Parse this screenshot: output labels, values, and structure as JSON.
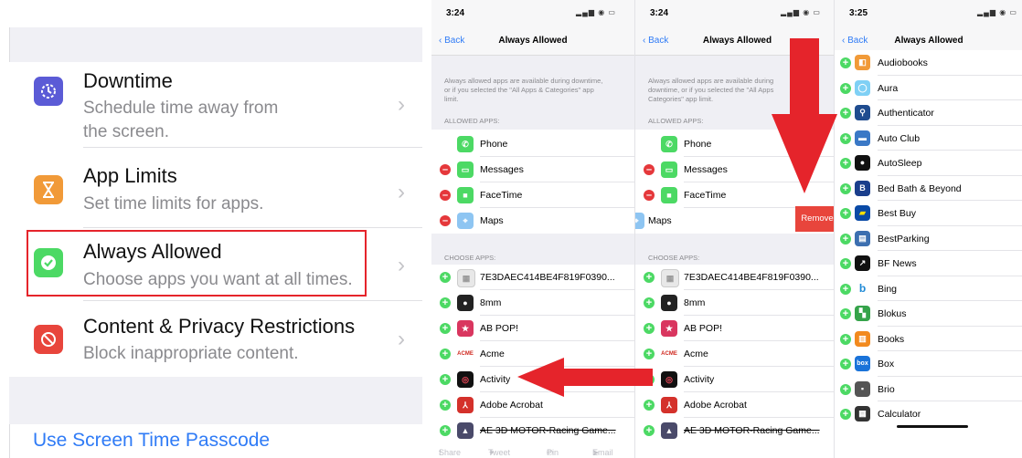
{
  "settings": {
    "rows": [
      {
        "title": "Downtime",
        "subtitle1": "Schedule time away from",
        "subtitle2": "the screen.",
        "icon": "downtime-icon",
        "color": "#5b5bd6"
      },
      {
        "title": "App Limits",
        "subtitle1": "Set time limits for apps.",
        "icon": "hourglass-icon",
        "color": "#f19a38"
      },
      {
        "title": "Always Allowed",
        "subtitle1": "Choose apps you want at all times.",
        "icon": "checkmark-badge-icon",
        "color": "#4cd964"
      },
      {
        "title": "Content & Privacy Restrictions",
        "subtitle1": "Block inappropriate content.",
        "icon": "no-entry-icon",
        "color": "#e8453c"
      }
    ],
    "passcode_link": "Use Screen Time Passcode",
    "chevron": "›"
  },
  "panels": [
    {
      "time": "3:24",
      "back": "Back",
      "title": "Always Allowed"
    },
    {
      "time": "3:24",
      "back": "Back",
      "title": "Always Allowed"
    },
    {
      "time": "3:25",
      "back": "Back",
      "title": "Always Allowed"
    }
  ],
  "always_allowed": {
    "description": "Always allowed apps are available during downtime, or if you selected the \"All Apps & Categories\" app limit.",
    "description_clipped": "Always allowed apps are available during downtime, or if you selected the \"All Apps Categories\" app limit.",
    "allowed_header": "ALLOWED APPS:",
    "choose_header": "CHOOSE APPS:",
    "allowed_apps": [
      "Phone",
      "Messages",
      "FaceTime",
      "Maps"
    ],
    "choose_apps": [
      "7E3DAEC414BE4F819F0390...",
      "8mm",
      "AB POP!",
      "Acme",
      "Activity",
      "Adobe Acrobat",
      "AE 3D MOTOR-Racing Game..."
    ],
    "remove_label": "Remove"
  },
  "az_list": [
    "Audiobooks",
    "Aura",
    "Authenticator",
    "Auto Club",
    "AutoSleep",
    "Bed Bath & Beyond",
    "Best Buy",
    "BestParking",
    "BF News",
    "Bing",
    "Blokus",
    "Books",
    "Box",
    "Brio",
    "Calculator"
  ],
  "share_bar": [
    "Share",
    "Tweet",
    "Pin",
    "Email"
  ],
  "colors": {
    "accent": "#2f7bf6",
    "highlight_box": "#e5242b",
    "arrow": "#e5242b",
    "add": "#4cd964",
    "delete": "#e5383b"
  }
}
